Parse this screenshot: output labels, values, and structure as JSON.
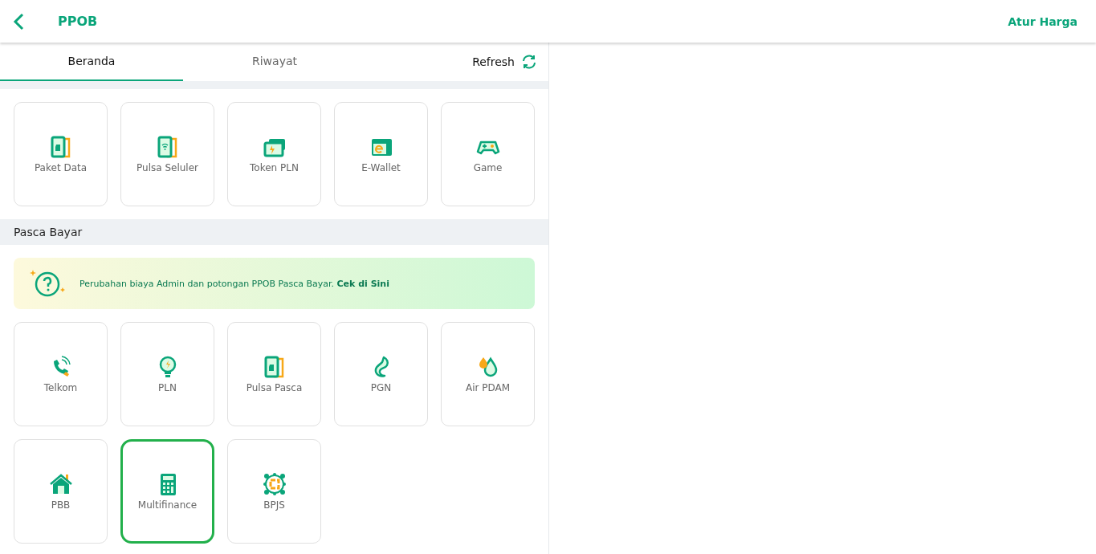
{
  "header": {
    "title": "PPOB",
    "action": "Atur Harga"
  },
  "tabs": [
    {
      "label": "Beranda",
      "selected": true
    },
    {
      "label": "Riwayat",
      "selected": false
    }
  ],
  "refresh": {
    "label": "Refresh"
  },
  "prabayar": {
    "items": [
      {
        "label": "Paket Data",
        "selected": false
      },
      {
        "label": "Pulsa Seluler",
        "selected": false
      },
      {
        "label": "Token PLN",
        "selected": false
      },
      {
        "label": "E-Wallet",
        "selected": false
      },
      {
        "label": "Game",
        "selected": false
      }
    ]
  },
  "pascabayar": {
    "title": "Pasca Bayar",
    "banner": {
      "text": "Perubahan biaya Admin dan potongan PPOB Pasca Bayar. **Cek di Sini**"
    },
    "items": [
      {
        "label": "Telkom",
        "selected": false
      },
      {
        "label": "PLN",
        "selected": false
      },
      {
        "label": "Pulsa Pasca",
        "selected": false
      },
      {
        "label": "PGN",
        "selected": false
      },
      {
        "label": "Air PDAM",
        "selected": false
      },
      {
        "label": "PBB",
        "selected": false
      },
      {
        "label": "Multifinance",
        "selected": true
      },
      {
        "label": "BPJS",
        "selected": false
      }
    ]
  }
}
